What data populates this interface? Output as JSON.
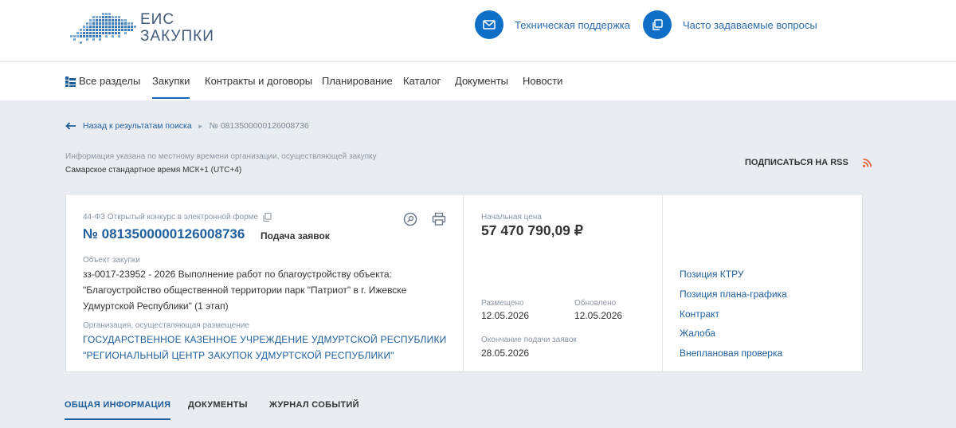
{
  "header": {
    "logo_line1": "ЕИС",
    "logo_line2": "ЗАКУПКИ",
    "support_label": "Техническая поддержка",
    "faq_label": "Часто задаваемые вопросы",
    "accent": "#0f6fc6"
  },
  "nav": {
    "items": [
      "Все разделы",
      "Закупки",
      "Контракты и договоры",
      "Планирование",
      "Каталог",
      "Документы",
      "Новости"
    ],
    "active": "Закупки"
  },
  "breadcrumb": {
    "back": "Назад к результатам поиска",
    "current": "№ 0813500000126008736"
  },
  "timezone": {
    "note": "Информация указана по местному времени организации, осуществляющей закупку",
    "value": "Самарское стандартное время МСК+1 (UTC+4)"
  },
  "rss_label": "ПОДПИСАТЬСЯ НА RSS",
  "procurement": {
    "law_type": "44-ФЗ Открытый конкурс в электронной форме",
    "number": "№ 0813500000126008736",
    "stage": "Подача заявок",
    "object_label": "Объект закупки",
    "object_lines": [
      "зз-0017-23952 - 2026 Выполнение работ по благоустройству объекта:",
      "\"Благоустройство общественной территории парк \"Патриот\" в г. Ижевске",
      "Удмуртской Республики\" (1 этап)"
    ],
    "org_label": "Организация, осуществляющая размещение",
    "org_lines": [
      "ГОСУДАРСТВЕННОЕ КАЗЕННОЕ УЧРЕЖДЕНИЕ УДМУРТСКОЙ РЕСПУБЛИКИ",
      "\"РЕГИОНАЛЬНЫЙ ЦЕНТР ЗАКУПОК УДМУРТСКОЙ РЕСПУБЛИКИ\""
    ],
    "price_label": "Начальная цена",
    "price": "57 470 790,09 ₽",
    "posted_label": "Размещено",
    "posted": "12.05.2026",
    "updated_label": "Обновлено",
    "updated": "12.05.2026",
    "deadline_label": "Окончание подачи заявок",
    "deadline": "28.05.2026",
    "links": [
      "Позиция КТРУ",
      "Позиция плана-графика",
      "Контракт",
      "Жалоба",
      "Внеплановая проверка"
    ]
  },
  "tabs": {
    "items": [
      "ОБЩАЯ ИНФОРМАЦИЯ",
      "ДОКУМЕНТЫ",
      "ЖУРНАЛ СОБЫТИЙ"
    ],
    "active": "ОБЩАЯ ИНФОРМАЦИЯ"
  },
  "icons": {
    "support": "envelope-icon",
    "faq": "copy-icon",
    "all_sections": "grid-icon",
    "back": "arrow-left-icon",
    "copy": "copy-icon",
    "search": "search-icon",
    "print": "printer-icon",
    "rss": "rss-icon"
  }
}
